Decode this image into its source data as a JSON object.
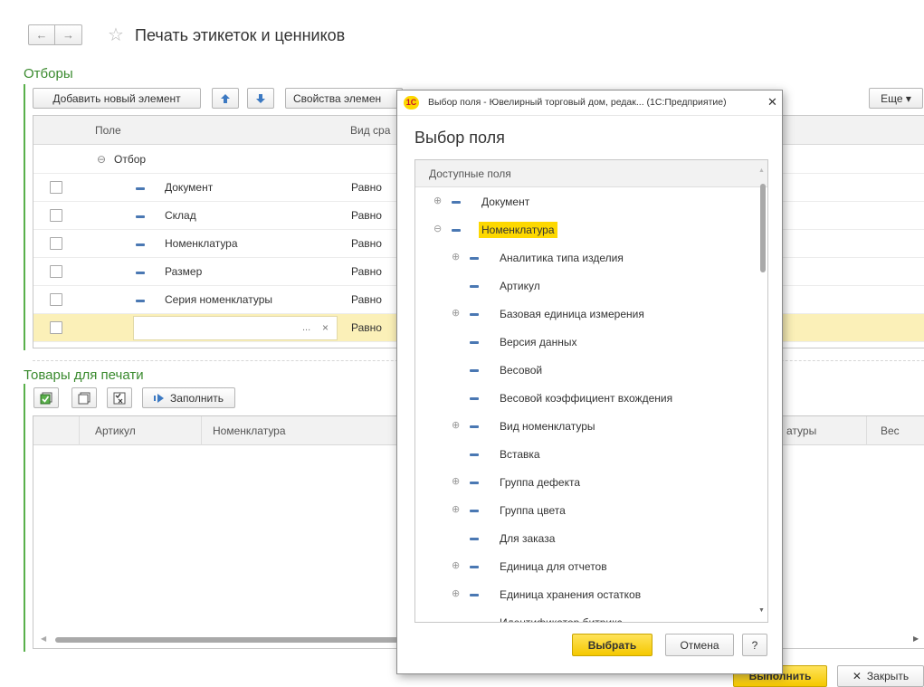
{
  "header": {
    "back_arrow": "←",
    "forward_arrow": "→",
    "star": "☆",
    "title": "Печать этикеток и ценников"
  },
  "filters": {
    "section_title": "Отборы",
    "toolbar": {
      "add_label": "Добавить новый элемент",
      "properties_label": "Свойства элемен",
      "more_label": "Еще ▾"
    },
    "columns": {
      "field": "Поле",
      "comparison": "Вид сра"
    },
    "group_label": "Отбор",
    "rows": [
      {
        "field": "Документ",
        "comparison": "Равно"
      },
      {
        "field": "Склад",
        "comparison": "Равно"
      },
      {
        "field": "Номенклатура",
        "comparison": "Равно"
      },
      {
        "field": "Размер",
        "comparison": "Равно"
      },
      {
        "field": "Серия номенклатуры",
        "comparison": "Равно"
      }
    ],
    "edit_row": {
      "comparison": "Равно",
      "ellipsis": "...",
      "clear": "×"
    }
  },
  "goods": {
    "section_title": "Товары для печати",
    "fill_label": "Заполнить",
    "columns": {
      "article": "Артикул",
      "nomenclature": "Номенклатура",
      "nomenclature_tail": "атуры",
      "weight": "Вес"
    }
  },
  "footer": {
    "execute_label": "Выполнить",
    "close_label": "Закрыть",
    "close_glyph": "✕"
  },
  "modal": {
    "window_title": "Выбор поля - Ювелирный торговый дом, редак... (1С:Предприятие)",
    "app_badge": "1С",
    "close_glyph": "✕",
    "heading": "Выбор поля",
    "tree_header": "Доступные поля",
    "items": [
      {
        "label": "Документ",
        "level": 0,
        "expander": "plus"
      },
      {
        "label": "Номенклатура",
        "level": 0,
        "expander": "minus",
        "highlighted": true
      },
      {
        "label": "Аналитика типа изделия",
        "level": 1,
        "expander": "plus"
      },
      {
        "label": "Артикул",
        "level": 1,
        "expander": "none"
      },
      {
        "label": "Базовая единица измерения",
        "level": 1,
        "expander": "plus"
      },
      {
        "label": "Версия данных",
        "level": 1,
        "expander": "none"
      },
      {
        "label": "Весовой",
        "level": 1,
        "expander": "none"
      },
      {
        "label": "Весовой коэффициент вхождения",
        "level": 1,
        "expander": "none"
      },
      {
        "label": "Вид номенклатуры",
        "level": 1,
        "expander": "plus"
      },
      {
        "label": "Вставка",
        "level": 1,
        "expander": "none"
      },
      {
        "label": "Группа дефекта",
        "level": 1,
        "expander": "plus"
      },
      {
        "label": "Группа цвета",
        "level": 1,
        "expander": "plus"
      },
      {
        "label": "Для заказа",
        "level": 1,
        "expander": "none"
      },
      {
        "label": "Единица для отчетов",
        "level": 1,
        "expander": "plus"
      },
      {
        "label": "Единица хранения остатков",
        "level": 1,
        "expander": "plus"
      },
      {
        "label": "Идентификатор битрикс",
        "level": 1,
        "expander": "none"
      }
    ],
    "select_label": "Выбрать",
    "cancel_label": "Отмена",
    "help_label": "?"
  },
  "colors": {
    "accent_green": "#3a8a2e",
    "highlight_yellow": "#fdd800",
    "selected_row": "#fbf0b8",
    "dash_blue": "#4a78b3"
  }
}
